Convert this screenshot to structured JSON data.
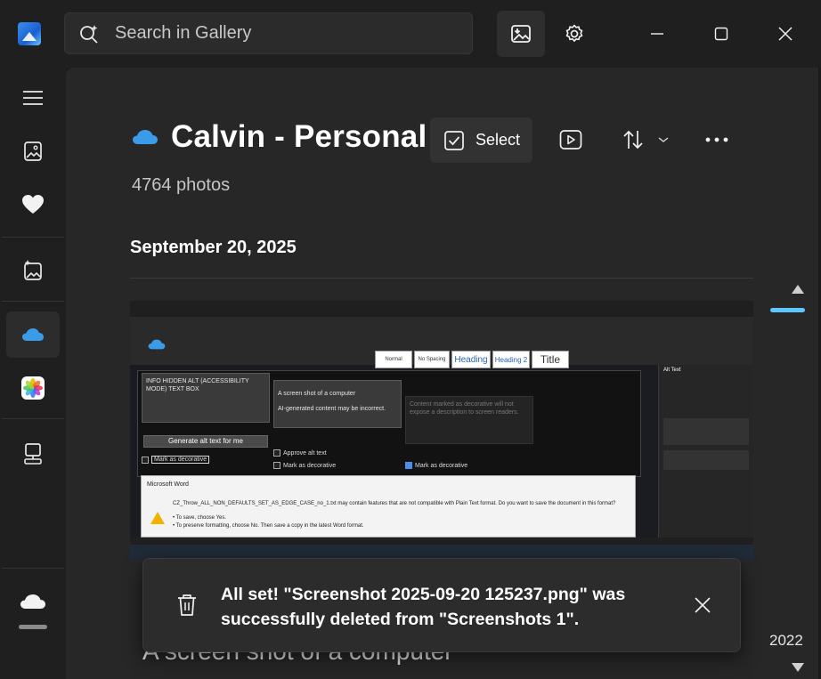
{
  "search": {
    "placeholder": "Search in Gallery"
  },
  "album": {
    "title": "Calvin - Personal",
    "select_label": "Select",
    "photo_count": "4764 photos",
    "date_header": "September 20, 2025"
  },
  "sidebar": {
    "items": [
      {
        "icon": "hamburger-menu-icon"
      },
      {
        "icon": "photos-icon"
      },
      {
        "icon": "favorites-heart-icon"
      },
      {
        "icon": "ai-photos-icon"
      },
      {
        "icon": "onedrive-icon",
        "selected": true
      },
      {
        "icon": "icloud-photos-icon"
      },
      {
        "icon": "pc-folders-icon"
      },
      {
        "icon": "cloud-icon"
      }
    ]
  },
  "thumbnail": {
    "alt_box_title": "INFO HIDDEN ALT (ACCESSIBILITY MODE) TEXT BOX",
    "generate_btn": "Generate alt text for me",
    "mark_decorative": "Mark as decorative",
    "box2_line1": "A screen shot of a computer",
    "box2_line2": "AI-generated content may be incorrect.",
    "approve_alt": "Approve alt text",
    "box3_text": "Content marked as decorative will not expose a description to screen readers.",
    "dialog_title": "Microsoft Word",
    "dialog_msg": "CZ_Throw_ALL_NON_DEFAULTS_SET_AS_EDGE_CASE_no_1.txt may contain features that are not compatible with Plain Text format. Do you want to save the document in this format?",
    "dialog_l1": "• To save, choose Yes.",
    "dialog_l2": "• To preserve formatting, choose No. Then save a copy in the latest Word format.",
    "pane_title": "Alt Text",
    "styles": [
      "Normal",
      "No Spacing",
      "Heading",
      "Heading 2",
      "Title"
    ],
    "second_text": "A screen shot of a computer"
  },
  "timeline": {
    "year": "2022"
  },
  "toast": {
    "message": "All set! \"Screenshot 2025-09-20 125237.png\" was successfully deleted from \"Screenshots 1\"."
  },
  "colors": {
    "accent": "#60c6ff",
    "onedrive_blue": "#3b9be8",
    "background": "#1b1b1b",
    "panel": "#272727"
  }
}
